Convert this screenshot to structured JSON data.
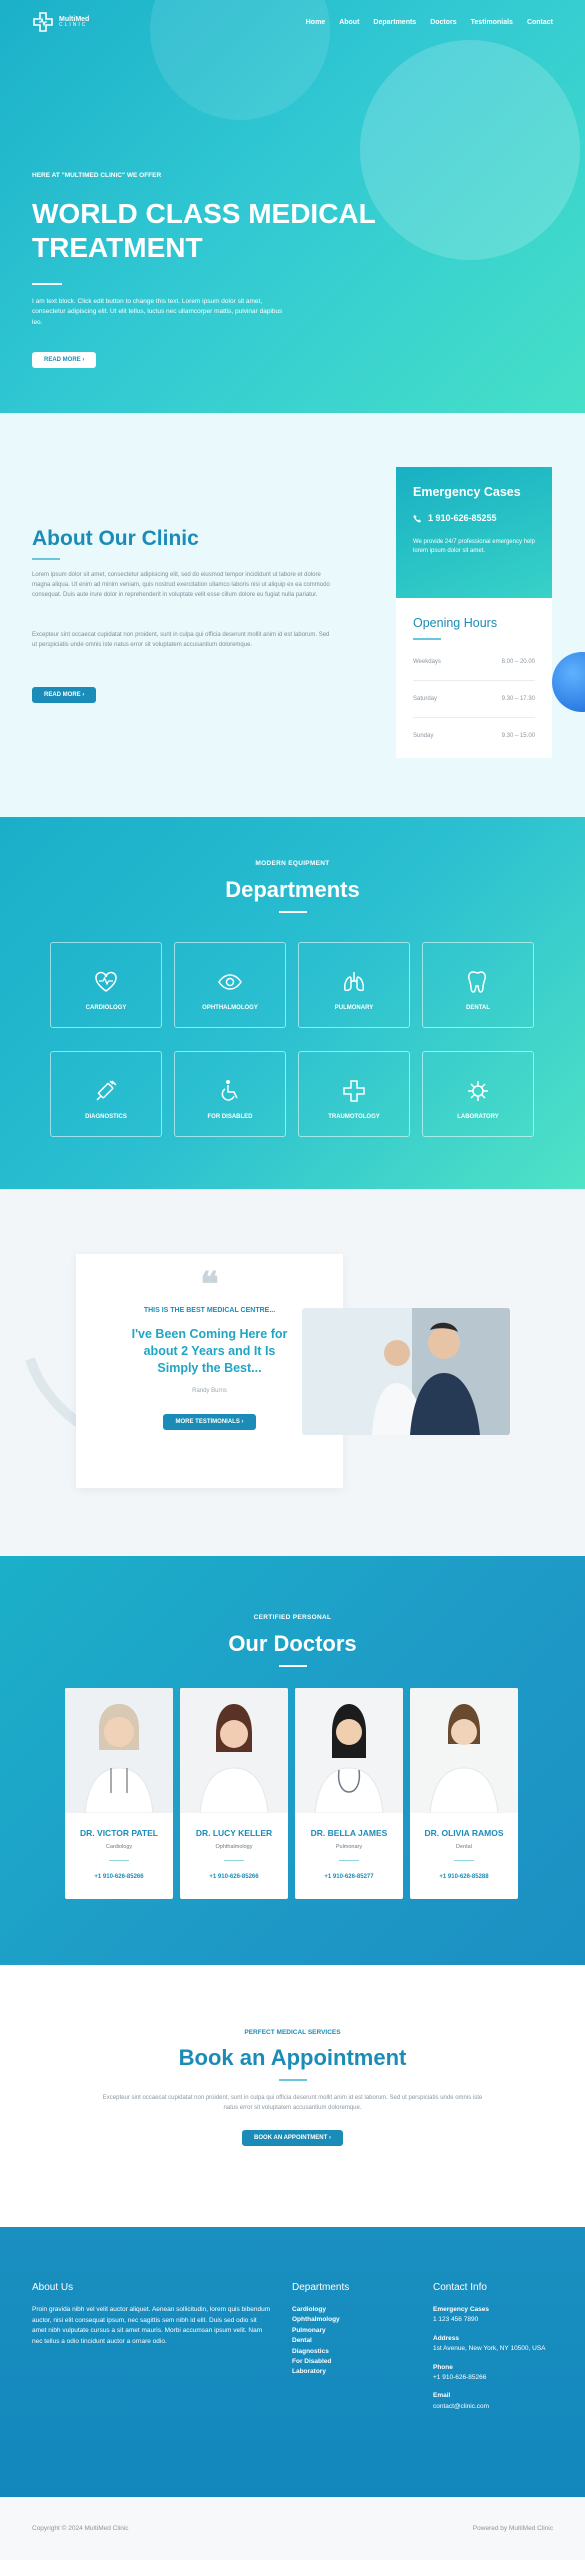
{
  "nav": {
    "logo_line1": "MultiMed",
    "logo_line2": "CLINIC",
    "items": [
      "Home",
      "About",
      "Departments",
      "Doctors",
      "Testimonials",
      "Contact"
    ]
  },
  "hero": {
    "eyebrow": "HERE AT \"MULTIMED CLINIC\" WE OFFER",
    "title": "WORLD CLASS MEDICAL TREATMENT",
    "text": "I am text block. Click edit button to change this text. Lorem ipsum dolor sit amet, consectetur adipiscing elit. Ut elit tellus, luctus nec ullamcorper mattis, pulvinar dapibus leo.",
    "button": "READ MORE"
  },
  "about": {
    "title": "About Our Clinic",
    "p1": "Lorem ipsum dolor sit amet, consectetur adipisicing elit, sed do eiusmod tempor incididunt ut labore et dolore magna aliqua. Ut enim ad minim veniam, quis nostrud exercitation ullamco laboris nisi ut aliquip ex ea commodo consequat. Duis aute irure dolor in reprehenderit in voluptate velit esse cillum dolore eu fugiat nulla pariatur.",
    "p2": "Excepteur sint occaecat cupidatat non proident, sunt in culpa qui officia deserunt mollit anim id est laborum. Sed ut perspiciatis unde omnis iste natus error sit voluptatem accusantium doloremque.",
    "button": "READ MORE"
  },
  "emergency": {
    "title": "Emergency Cases",
    "phone": "1 910-626-85255",
    "text": "We provide 24/7 professional emergency help lorem ipsum dolor sit amet."
  },
  "hours": {
    "title": "Opening Hours",
    "rows": [
      {
        "day": "Weekdays",
        "time": "8.00 – 20.00"
      },
      {
        "day": "Saturday",
        "time": "9.30 – 17.30"
      },
      {
        "day": "Sunday",
        "time": "9.30 – 15.00"
      }
    ]
  },
  "departments": {
    "eyebrow": "MODERN EQUIPMENT",
    "title": "Departments",
    "items": [
      {
        "label": "CARDIOLOGY",
        "icon": "heart-pulse-icon"
      },
      {
        "label": "OPHTHALMOLOGY",
        "icon": "eye-icon"
      },
      {
        "label": "PULMONARY",
        "icon": "lungs-icon"
      },
      {
        "label": "DENTAL",
        "icon": "tooth-icon"
      },
      {
        "label": "DIAGNOSTICS",
        "icon": "syringe-icon"
      },
      {
        "label": "FOR DISABLED",
        "icon": "wheelchair-icon"
      },
      {
        "label": "TRAUMOTOLOGY",
        "icon": "medical-cross-icon"
      },
      {
        "label": "LABORATORY",
        "icon": "virus-icon"
      }
    ]
  },
  "testimonial": {
    "eyebrow": "THIS IS THE BEST MEDICAL CENTRE...",
    "title": "I've Been Coming Here for about 2 Years and It Is Simply the Best...",
    "name": "Randy Burns",
    "button": "MORE TESTIMONIALS"
  },
  "doctors": {
    "eyebrow": "CERTIFIED PERSONAL",
    "title": "Our Doctors",
    "items": [
      {
        "name": "DR. VICTOR PATEL",
        "specialty": "Cardiology",
        "phone": "+1 910-626-85266"
      },
      {
        "name": "DR. LUCY KELLER",
        "specialty": "Ophthalmology",
        "phone": "+1 910-626-85266"
      },
      {
        "name": "DR. BELLA JAMES",
        "specialty": "Pulmonary",
        "phone": "+1 910-626-85277"
      },
      {
        "name": "DR. OLIVIA RAMOS",
        "specialty": "Dental",
        "phone": "+1 910-626-85288"
      }
    ]
  },
  "appointment": {
    "eyebrow": "PERFECT MEDICAL SERVICES",
    "title": "Book an Appointment",
    "text": "Excepteur sint occaecat cupidatat non proident, sunt in culpa qui officia deserunt mollit anim id est laborum. Sed ut perspiciatis unde omnis iste natus error sit voluptatem accusantium doloremque.",
    "button": "BOOK AN APPOINTMENT"
  },
  "footer": {
    "about_title": "About Us",
    "about_text": "Proin gravida nibh vel velit auctor aliquet. Aenean sollicitudin, lorem quis bibendum auctor, nisi elit consequat ipsum, nec sagittis sem nibh id elit. Duis sed odio sit amet nibh vulputate cursus a sit amet mauris. Morbi accumsan ipsum velit. Nam nec tellus a odio tincidunt auctor a ornare odio.",
    "depts_title": "Departments",
    "depts": [
      "Cardiology",
      "Ophthalmology",
      "Pulmonary",
      "Dental",
      "Diagnostics",
      "For Disabled",
      "Laboratory"
    ],
    "contact_title": "Contact Info",
    "contacts": [
      {
        "label": "Emergency Cases",
        "value": "1 123 456 7890"
      },
      {
        "label": "Address",
        "value": "1st Avenue, New York, NY 10500, USA"
      },
      {
        "label": "Phone",
        "value": "+1 910-626-85266"
      },
      {
        "label": "Email",
        "value": "contact@clinic.com"
      }
    ]
  },
  "bottom": {
    "copyright": "Copyright © 2024 MultiMed Clinic",
    "powered": "Powered by MultiMed Clinic"
  },
  "colors": {
    "primary": "#1b8cb8",
    "teal": "#31c8d3",
    "mint": "#4fe3c6"
  }
}
